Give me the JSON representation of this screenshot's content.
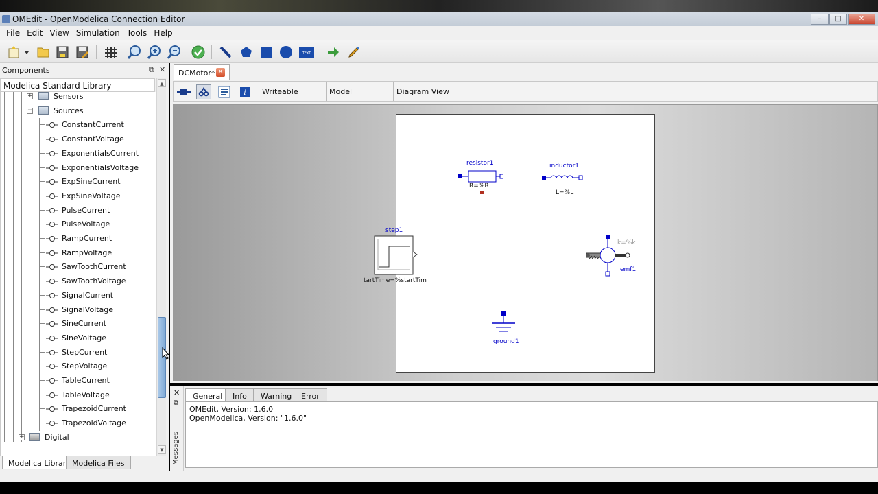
{
  "window": {
    "title": "OMEdit - OpenModelica Connection Editor",
    "buttons": [
      "–",
      "□",
      "✕"
    ]
  },
  "menu": [
    "File",
    "Edit",
    "View",
    "Simulation",
    "Tools",
    "Help"
  ],
  "toolbar": {
    "icons": [
      "new-model-icon",
      "open-folder-icon",
      "save-icon",
      "save-as-icon",
      "grid-icon",
      "zoom-100-icon",
      "zoom-in-icon",
      "zoom-out-icon",
      "check-model-icon",
      "line-tool-icon",
      "polygon-tool-icon",
      "rectangle-tool-icon",
      "ellipse-tool-icon",
      "text-tool-icon",
      "connect-mode-icon",
      "simulate-icon"
    ]
  },
  "components_panel": {
    "title": "Components",
    "library_title": "Modelica Standard Library",
    "tree": [
      {
        "label": "Sensors",
        "level": 1,
        "expander": "+"
      },
      {
        "label": "Sources",
        "level": 1,
        "expander": "−"
      },
      {
        "label": "ConstantCurrent",
        "level": 2
      },
      {
        "label": "ConstantVoltage",
        "level": 2
      },
      {
        "label": "ExponentialsCurrent",
        "level": 2
      },
      {
        "label": "ExponentialsVoltage",
        "level": 2
      },
      {
        "label": "ExpSineCurrent",
        "level": 2
      },
      {
        "label": "ExpSineVoltage",
        "level": 2
      },
      {
        "label": "PulseCurrent",
        "level": 2
      },
      {
        "label": "PulseVoltage",
        "level": 2
      },
      {
        "label": "RampCurrent",
        "level": 2
      },
      {
        "label": "RampVoltage",
        "level": 2
      },
      {
        "label": "SawToothCurrent",
        "level": 2
      },
      {
        "label": "SawToothVoltage",
        "level": 2
      },
      {
        "label": "SignalCurrent",
        "level": 2
      },
      {
        "label": "SignalVoltage",
        "level": 2
      },
      {
        "label": "SineCurrent",
        "level": 2
      },
      {
        "label": "SineVoltage",
        "level": 2
      },
      {
        "label": "StepCurrent",
        "level": 2
      },
      {
        "label": "StepVoltage",
        "level": 2
      },
      {
        "label": "TableCurrent",
        "level": 2
      },
      {
        "label": "TableVoltage",
        "level": 2
      },
      {
        "label": "TrapezoidCurrent",
        "level": 2
      },
      {
        "label": "TrapezoidVoltage",
        "level": 2
      },
      {
        "label": "Digital",
        "level": 0,
        "expander": "+"
      }
    ],
    "bottom_tabs": [
      "Modelica Library",
      "Modelica Files"
    ]
  },
  "editor": {
    "tab_label": "DCMotor*",
    "model_bar": {
      "icons": [
        "icon-view-icon",
        "diagram-view-icon",
        "text-view-icon",
        "documentation-icon"
      ],
      "fields": [
        "Writeable",
        "Model",
        "Diagram View"
      ]
    },
    "diagram": {
      "resistor": {
        "name": "resistor1",
        "param": "R=%R"
      },
      "inductor": {
        "name": "inductor1",
        "param": "L=%L"
      },
      "step": {
        "name": "step1",
        "param": "tartTime=%startTim"
      },
      "emf": {
        "name": "emf1",
        "param": "k=%k"
      },
      "ground": {
        "name": "ground1"
      }
    }
  },
  "messages": {
    "side_label": "Messages",
    "tabs": [
      "General",
      "Info",
      "Warning",
      "Error"
    ],
    "lines": [
      "OMEdit, Version: 1.6.0",
      "OpenModelica, Version: \"1.6.0\""
    ]
  },
  "colors": {
    "accent_blue": "#0000c8",
    "connector_red": "#b03020"
  }
}
